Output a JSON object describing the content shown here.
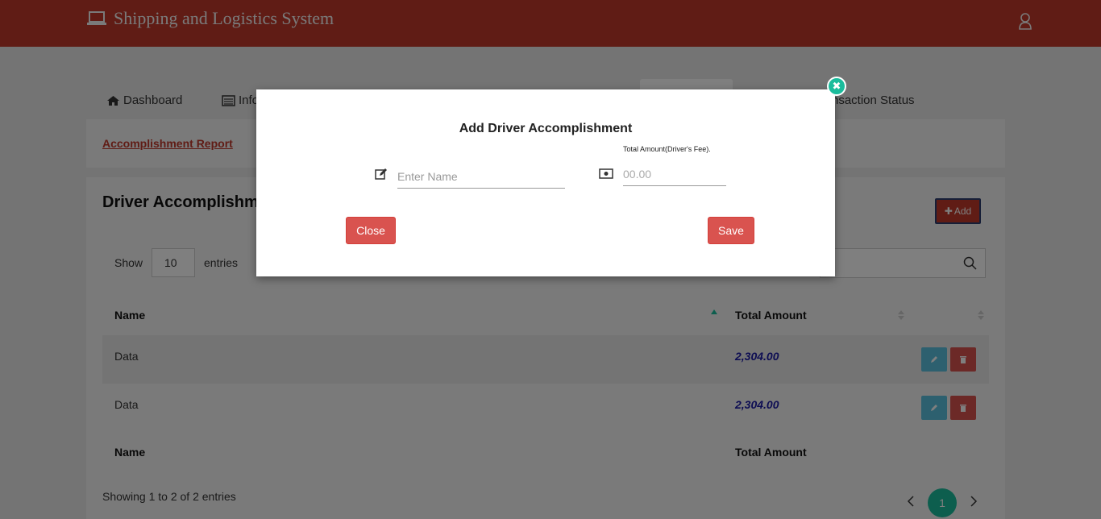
{
  "header": {
    "title": "Shipping and Logistics System"
  },
  "nav": {
    "items": [
      {
        "label": "Dashboard",
        "icon": "home-icon"
      },
      {
        "label": "Info",
        "icon": "list-icon"
      },
      {
        "label": "nsaction Status",
        "icon": ""
      }
    ]
  },
  "report": {
    "link": "Accomplishment Report"
  },
  "panel": {
    "title": "Driver Accomplishme",
    "add_label": "Add",
    "show_label": "Show",
    "show_value": "10",
    "entries_label": "entries",
    "columns": [
      "Name",
      "Total Amount"
    ],
    "rows": [
      {
        "name": "Data",
        "amount": "2,304.00"
      },
      {
        "name": "Data",
        "amount": "2,304.00"
      }
    ],
    "info": "Showing 1 to 2 of 2 entries",
    "current_page": "1"
  },
  "modal": {
    "title": "Add Driver Accomplishment",
    "name_placeholder": "Enter Name",
    "amount_label": "Total Amount(Driver's Fee).",
    "amount_placeholder": "00.00",
    "close_label": "Close",
    "save_label": "Save",
    "close_icon": "✖"
  },
  "colors": {
    "header": "#c0392b",
    "accent": "#1abc9c",
    "danger": "#d9534f",
    "info": "#5bc0de"
  }
}
